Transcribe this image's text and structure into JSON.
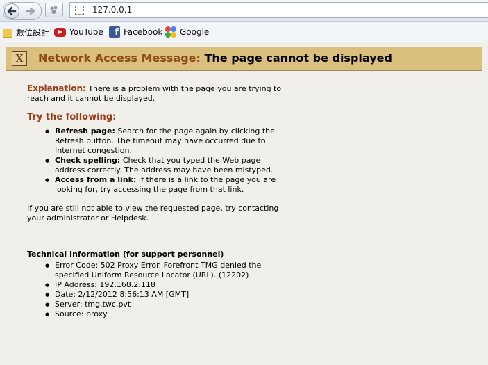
{
  "browser": {
    "url": "127.0.0.1",
    "bookmarks": [
      {
        "label": "數位設計",
        "icon": "folder-icon"
      },
      {
        "label": "YouTube",
        "icon": "youtube-icon"
      },
      {
        "label": "Facebook",
        "icon": "facebook-icon"
      },
      {
        "label": "Google",
        "icon": "google-icon"
      }
    ]
  },
  "banner": {
    "x_mark": "X",
    "prefix": "Network Access Message:",
    "title": "The page cannot be displayed"
  },
  "explanation": {
    "label": "Explanation:",
    "text": "There is a problem with the page you are trying to reach and it cannot be displayed."
  },
  "try": {
    "title": "Try the following:",
    "items": [
      {
        "label": "Refresh page:",
        "text": "Search for the page again by clicking the Refresh button. The timeout may have occurred due to Internet congestion."
      },
      {
        "label": "Check spelling:",
        "text": "Check that you typed the Web page address correctly. The address may have been mistyped."
      },
      {
        "label": "Access from a link:",
        "text": "If there is a link to the page you are looking for, try accessing the page from that link."
      }
    ]
  },
  "contact": "If you are still not able to view the requested page, try contacting your administrator or Helpdesk.",
  "tech": {
    "title": "Technical Information (for support personnel)",
    "items": [
      "Error Code: 502 Proxy Error. Forefront TMG denied the specified Uniform Resource Locator (URL). (12202)",
      "IP Address: 192.168.2.118",
      "Date: 2/12/2012 8:56:13 AM [GMT]",
      "Server: tmg.twc.pvt",
      "Source: proxy"
    ]
  }
}
